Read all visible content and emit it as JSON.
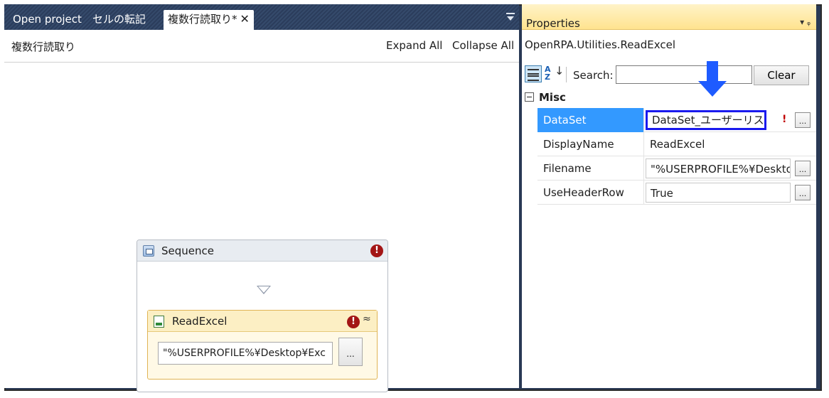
{
  "tabs": {
    "open_project": "Open project",
    "cell_transfer": "セルの転記",
    "active": "複数行読取り*",
    "active_close": "✕"
  },
  "designer": {
    "title": "複数行読取り",
    "expand_all": "Expand All",
    "collapse_all": "Collapse All",
    "sequence": {
      "title": "Sequence",
      "error_glyph": "!"
    },
    "readexcel": {
      "title": "ReadExcel",
      "error_glyph": "!",
      "collapse_glyph": "≈",
      "filename_value": "\"%USERPROFILE%¥Desktop¥Exc",
      "dots": "..."
    }
  },
  "properties": {
    "title": "Properties",
    "pin_glyph": "▾ ᵩ",
    "object_type": "OpenRPA.Utilities.ReadExcel",
    "search_label": "Search:",
    "search_value": "",
    "clear_label": "Clear",
    "category": "Misc",
    "rows": [
      {
        "name": "DataSet",
        "value": "DataSet_ユーザーリスト",
        "error_glyph": "!",
        "dots": "..."
      },
      {
        "name": "DisplayName",
        "value": "ReadExcel"
      },
      {
        "name": "Filename",
        "value": "\"%USERPROFILE%¥Deskto",
        "dots": "..."
      },
      {
        "name": "UseHeaderRow",
        "value": "True",
        "dots": "..."
      }
    ]
  },
  "colors": {
    "selection": "#3399ff",
    "highlight_box": "#1a1aee",
    "annotation_arrow": "#1e5bff",
    "error": "#a31515"
  }
}
